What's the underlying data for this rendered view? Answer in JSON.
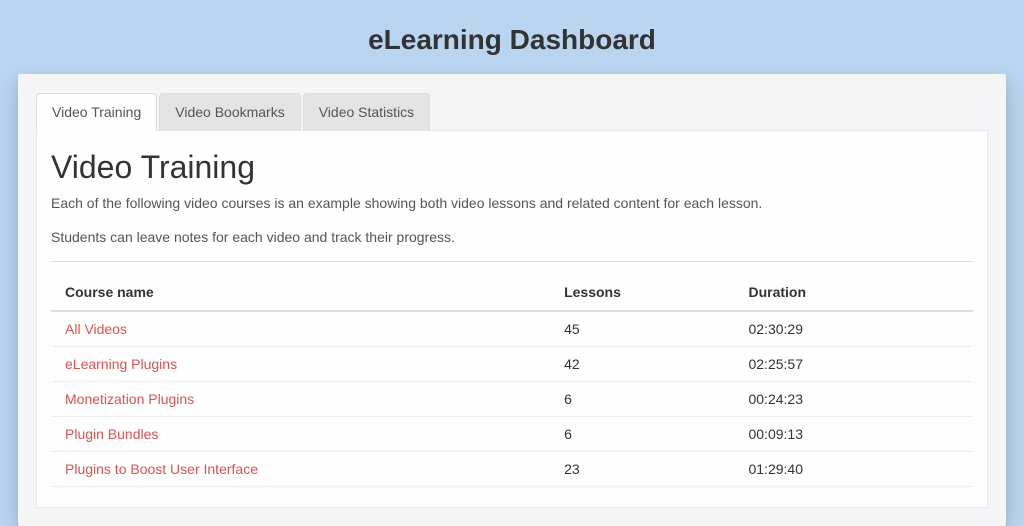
{
  "header": {
    "title": "eLearning Dashboard"
  },
  "tabs": [
    {
      "label": "Video Training"
    },
    {
      "label": "Video Bookmarks"
    },
    {
      "label": "Video Statistics"
    }
  ],
  "main": {
    "title": "Video Training",
    "description1": "Each of the following video courses is an example showing both video lessons and related content for each lesson.",
    "description2": "Students can leave notes for each video and track their progress."
  },
  "table": {
    "headers": {
      "course": "Course name",
      "lessons": "Lessons",
      "duration": "Duration"
    },
    "rows": [
      {
        "name": "All Videos",
        "lessons": "45",
        "duration": "02:30:29"
      },
      {
        "name": "eLearning Plugins",
        "lessons": "42",
        "duration": "02:25:57"
      },
      {
        "name": "Monetization Plugins",
        "lessons": "6",
        "duration": "00:24:23"
      },
      {
        "name": "Plugin Bundles",
        "lessons": "6",
        "duration": "00:09:13"
      },
      {
        "name": "Plugins to Boost User Interface",
        "lessons": "23",
        "duration": "01:29:40"
      }
    ]
  }
}
